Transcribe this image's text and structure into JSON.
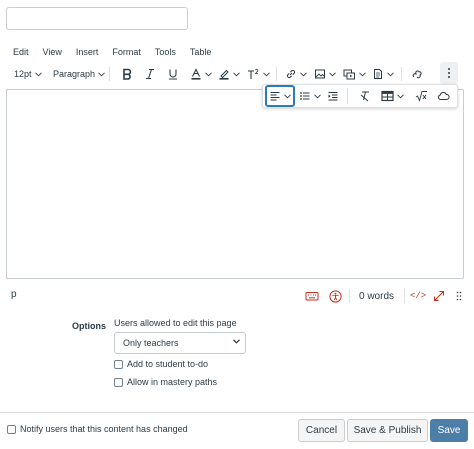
{
  "title_input": {
    "value": ""
  },
  "menubar": {
    "items": [
      "Edit",
      "View",
      "Insert",
      "Format",
      "Tools",
      "Table"
    ]
  },
  "toolbar": {
    "font_size": "12pt",
    "block_format": "Paragraph",
    "icons": [
      "bold-icon",
      "italic-icon",
      "underline-icon",
      "text-color-icon",
      "highlight-color-icon",
      "superscript-icon",
      "link-icon",
      "image-icon",
      "media-icon",
      "document-icon",
      "apps-icon",
      "more-icon"
    ]
  },
  "overflow_toolbar": {
    "icons": [
      "align-left-icon",
      "bulleted-list-icon",
      "indent-icon",
      "clear-formatting-icon",
      "table-icon",
      "equation-icon",
      "cloud-icon"
    ]
  },
  "statusbar": {
    "path": "p",
    "word_count": "0 words",
    "html_toggle": "</>"
  },
  "options": {
    "label": "Options",
    "users_label": "Users allowed to edit this page",
    "editors_select": "Only teachers",
    "todo_label": "Add to student to-do",
    "mastery_label": "Allow in mastery paths"
  },
  "footer": {
    "notify_label": "Notify users that this content has changed",
    "cancel_label": "Cancel",
    "save_publish_label": "Save & Publish",
    "save_label": "Save"
  },
  "colors": {
    "primary": "#4d7ea8",
    "text": "#2d3b45",
    "accent_red": "#c4301f",
    "focus": "#2b7abc"
  }
}
